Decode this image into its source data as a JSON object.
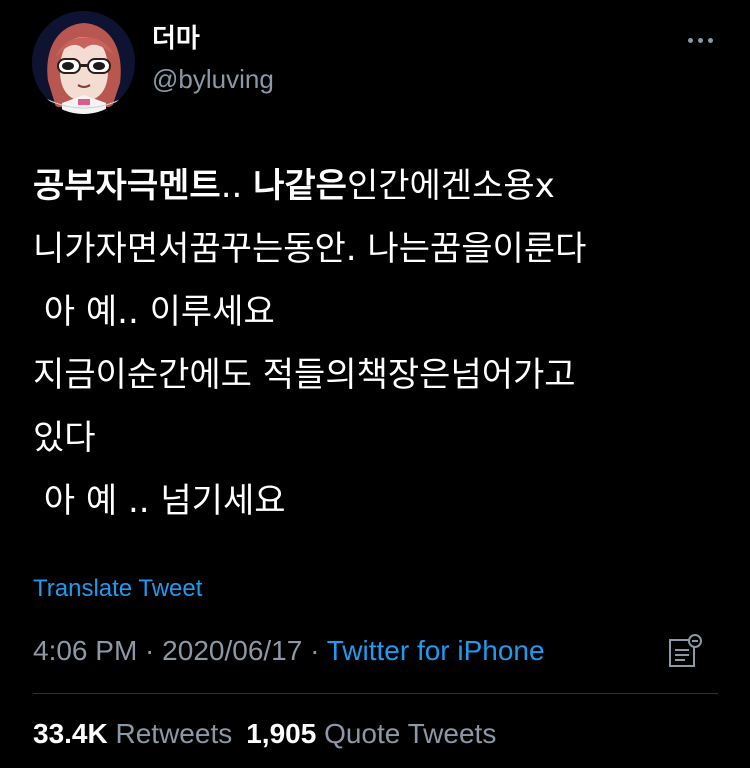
{
  "author": {
    "display_name": "더마",
    "handle": "@byluving",
    "avatar_icon": "anime-girl-sunglasses-avatar"
  },
  "more_icon": "more-horizontal-icon",
  "tweet": {
    "lines": [
      {
        "bold_a": "공부자극멘트",
        "normal_a": ".. ",
        "bold_b": "나같은",
        "normal_b": "인간에겐소용x"
      },
      {
        "text": "니가자면서꿈꾸는동안. 나는꿈을이룬다"
      },
      {
        "text": " 아 예.. 이루세요"
      },
      {
        "text": "지금이순간에도 적들의책장은넘어가고"
      },
      {
        "text": "있다"
      },
      {
        "text": " 아 예 .. 넘기세요"
      }
    ]
  },
  "translate_label": "Translate Tweet",
  "meta": {
    "time": "4:06 PM",
    "separator": " · ",
    "date": "2020/06/17",
    "source": "Twitter for iPhone"
  },
  "analytics_icon": "view-activity-icon",
  "stats": {
    "retweets_count": "33.4K",
    "retweets_label": "Retweets",
    "quotes_count": "1,905",
    "quotes_label": "Quote Tweets"
  },
  "colors": {
    "background": "#000000",
    "text_primary": "#ffffff",
    "text_secondary": "#8b98a5",
    "link": "#1d9bf0",
    "divider": "#2f3336"
  }
}
